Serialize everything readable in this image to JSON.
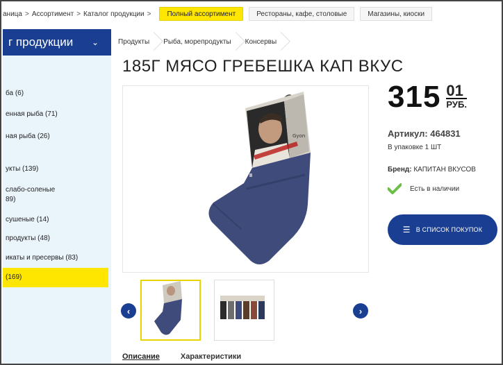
{
  "topbar": {
    "crumbs": [
      "аница",
      "Ассортимент",
      "Каталог продукции"
    ],
    "pills": [
      "Полный ассортимент",
      "Рестораны, кафе, столовые",
      "Магазины, киоски"
    ]
  },
  "sidebar": {
    "title": "г продукции",
    "items": [
      "ба (6)",
      "енная рыба (71)",
      "ная рыба (26)",
      "укты (139)",
      "слабо-соленые",
      "89)",
      "сушеные (14)",
      "продукты (48)",
      "икаты и пресервы (83)",
      "(169)"
    ]
  },
  "subnav": [
    "Продукты",
    "Рыба, морепродукты",
    "Консервы"
  ],
  "product": {
    "title": "185Г МЯСО ГРЕБЕШКА КАП ВКУС",
    "price_rub": "315",
    "price_kop": "01",
    "currency": "РУБ.",
    "sku": "Артикул: 464831",
    "pack": "В упаковке 1 ШТ",
    "brand_label": "Бренд:",
    "brand_value": "КАПИТАН ВКУСОВ",
    "stock": "Есть в наличии",
    "cart_button": "в список покупок",
    "label_text": "Gyon"
  },
  "tabs": [
    "Описание",
    "Характеристики"
  ],
  "colors": {
    "accent_blue": "#1a3f92",
    "accent_yellow": "#ffe600",
    "check_green": "#6cc04a"
  }
}
